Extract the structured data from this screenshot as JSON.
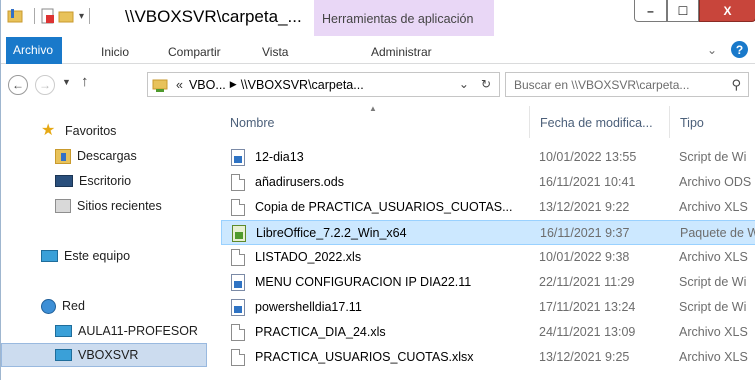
{
  "title": {
    "path": "\\\\VBOXSVR\\carpeta_...",
    "context_tab": "Herramientas de aplicación",
    "minimize": "–",
    "maximize": "☐",
    "close": "X"
  },
  "ribbon": {
    "tabs": [
      "Archivo",
      "Inicio",
      "Compartir",
      "Vista",
      "Administrar"
    ],
    "expand": "⌄",
    "help": "?"
  },
  "address": {
    "crumbs": [
      "VBO...",
      "\\\\VBOXSVR\\carpeta..."
    ],
    "prefix": "«",
    "dropdown": "⌄",
    "refresh": "↻"
  },
  "search": {
    "placeholder": "Buscar en \\\\VBOXSVR\\carpeta..."
  },
  "nav_pane": {
    "favorites": "Favoritos",
    "downloads": "Descargas",
    "desktop": "Escritorio",
    "recent": "Sitios recientes",
    "this_pc": "Este equipo",
    "network": "Red",
    "net_pc1": "AULA11-PROFESOR",
    "net_pc2": "VBOXSVR"
  },
  "columns": {
    "name": "Nombre",
    "date": "Fecha de modifica...",
    "type": "Tipo"
  },
  "files": [
    {
      "name": "12-dia13",
      "date": "10/01/2022 13:55",
      "type": "Script de Wi",
      "icon": "script"
    },
    {
      "name": "añadirusers.ods",
      "date": "16/11/2021 10:41",
      "type": "Archivo ODS",
      "icon": "doc"
    },
    {
      "name": "Copia de PRACTICA_USUARIOS_CUOTAS...",
      "date": "13/12/2021 9:22",
      "type": "Archivo XLS",
      "icon": "doc"
    },
    {
      "name": "LibreOffice_7.2.2_Win_x64",
      "date": "16/11/2021 9:37",
      "type": "Paquete de W",
      "icon": "msi"
    },
    {
      "name": "LISTADO_2022.xls",
      "date": "10/01/2022 9:38",
      "type": "Archivo XLS",
      "icon": "doc"
    },
    {
      "name": "MENU CONFIGURACION IP DIA22.11",
      "date": "22/11/2021 11:29",
      "type": "Script de Wi",
      "icon": "script"
    },
    {
      "name": "powershelldia17.11",
      "date": "17/11/2021 13:24",
      "type": "Script de Wi",
      "icon": "script"
    },
    {
      "name": "PRACTICA_DIA_24.xls",
      "date": "24/11/2021 13:09",
      "type": "Archivo XLS",
      "icon": "doc"
    },
    {
      "name": "PRACTICA_USUARIOS_CUOTAS.xlsx",
      "date": "13/12/2021 9:25",
      "type": "Archivo XLS",
      "icon": "doc"
    }
  ],
  "selected_file_index": 3
}
